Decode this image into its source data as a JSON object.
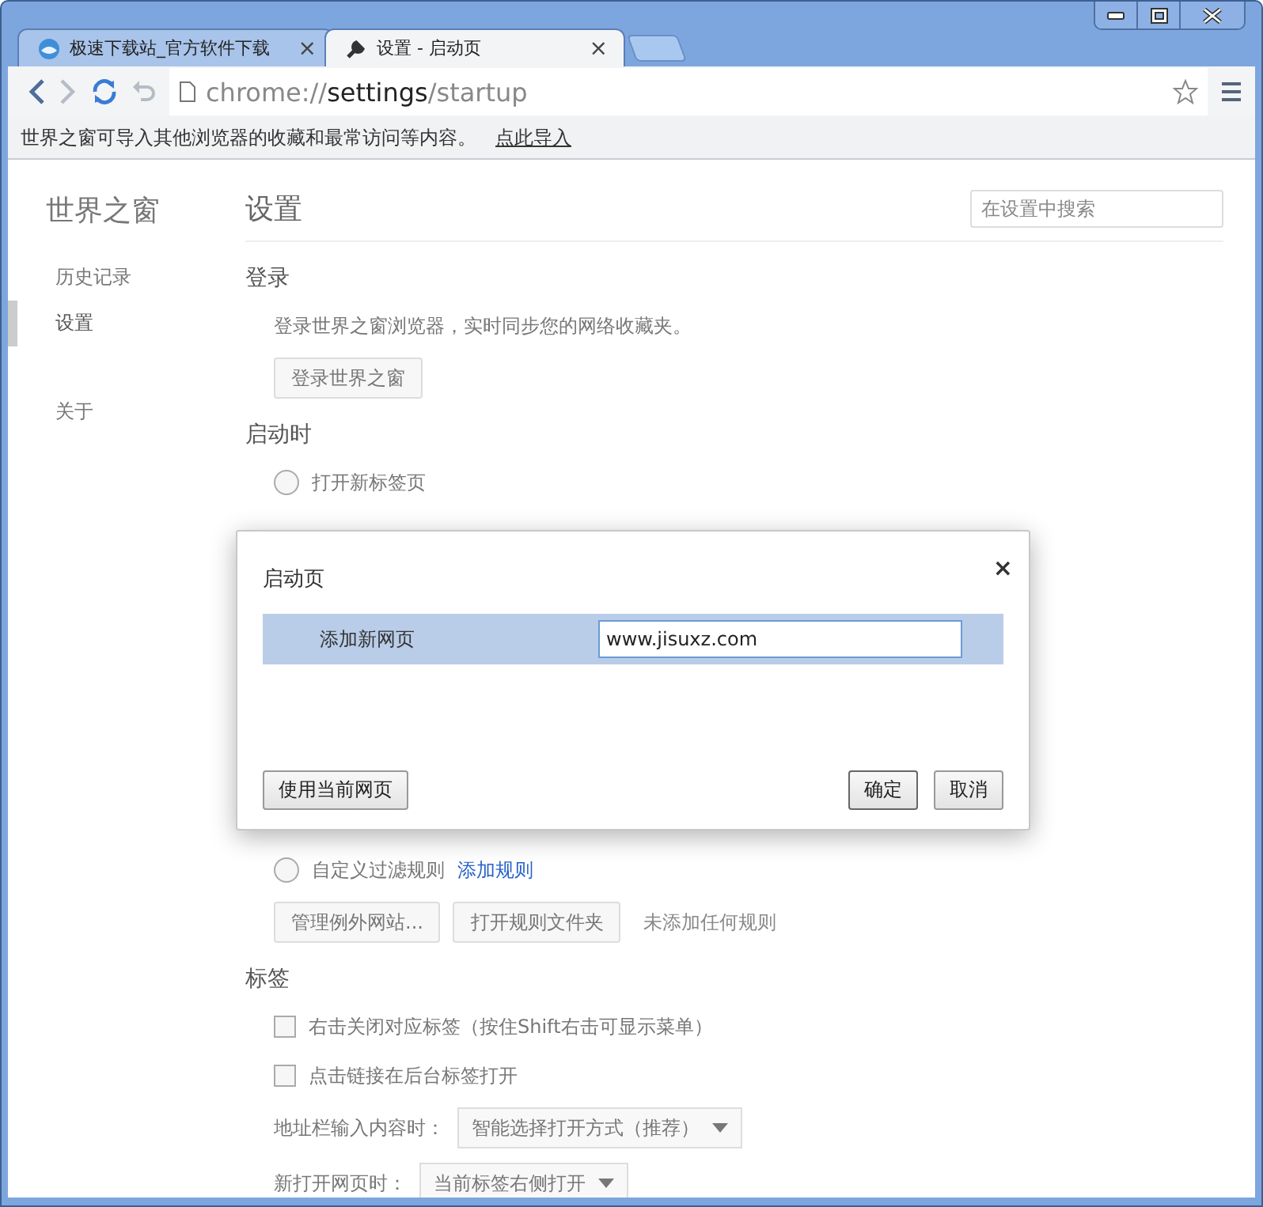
{
  "window": {
    "controls": [
      {
        "kind": "minimize"
      },
      {
        "kind": "maximize"
      },
      {
        "kind": "close"
      }
    ]
  },
  "tabs": [
    {
      "title": "极速下载站_官方软件下载",
      "selected": false,
      "close": "×"
    },
    {
      "title": "设置 - 启动页",
      "selected": true,
      "close": "×"
    }
  ],
  "toolbar": {
    "url": {
      "scheme": "chrome://",
      "host": "settings",
      "path": "/startup"
    }
  },
  "infobar": {
    "message": "世界之窗可导入其他浏览器的收藏和最常访问等内容。",
    "link": "点此导入"
  },
  "sidebar": {
    "title": "世界之窗",
    "items": [
      {
        "label": "历史记录",
        "selected": false
      },
      {
        "label": "设置",
        "selected": true
      },
      {
        "label": "关于",
        "selected": false
      }
    ]
  },
  "settings": {
    "title": "设置",
    "search": {
      "placeholder": "在设置中搜索"
    },
    "sections": [
      {
        "heading": "登录",
        "items": [
          {
            "kind": "text",
            "text": "登录世界之窗浏览器，实时同步您的网络收藏夹。"
          },
          {
            "kind": "buttons",
            "buttons": [
              "登录世界之窗"
            ]
          }
        ]
      },
      {
        "heading": "启动时",
        "items": [
          {
            "kind": "radio",
            "label": "打开新标签页",
            "checked": false
          },
          {
            "kind": "hidden"
          },
          {
            "kind": "radio",
            "label": "自定义过滤规则",
            "link": "添加规则",
            "checked": false
          },
          {
            "kind": "buttons",
            "buttons": [
              "管理例外网站...",
              "打开规则文件夹"
            ],
            "note": "未添加任何规则"
          }
        ]
      },
      {
        "heading": "标签",
        "items": [
          {
            "kind": "checkbox",
            "label": "右击关闭对应标签（按住Shift右击可显示菜单）",
            "checked": false
          },
          {
            "kind": "checkbox",
            "label": "点击链接在后台标签打开",
            "checked": false
          },
          {
            "kind": "select",
            "label": "地址栏输入内容时：",
            "value": "智能选择打开方式（推荐）"
          },
          {
            "kind": "select",
            "label": "新打开网页时：",
            "value": "当前标签右侧打开"
          }
        ]
      }
    ]
  },
  "dialog": {
    "title": "启动页",
    "close": "×",
    "row": {
      "label": "添加新网页",
      "value": "www.jisuxz.com"
    },
    "left_button": "使用当前网页",
    "buttons": [
      "确定",
      "取消"
    ]
  }
}
